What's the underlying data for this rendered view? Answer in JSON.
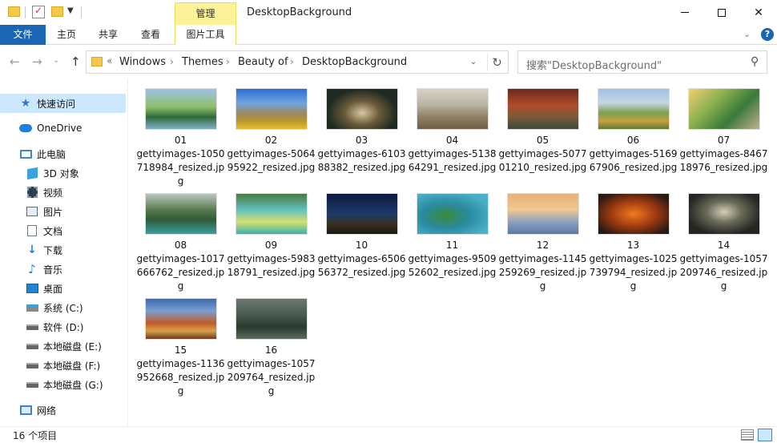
{
  "window": {
    "title": "DesktopBackground",
    "context_tab_group": "管理"
  },
  "ribbon": {
    "tabs": [
      "文件",
      "主页",
      "共享",
      "查看",
      "图片工具"
    ]
  },
  "nav": {
    "breadcrumbs": [
      "Windows",
      "Themes",
      "Beauty of",
      "DesktopBackground"
    ],
    "search_placeholder": "搜索\"DesktopBackground\""
  },
  "sidebar": {
    "items": [
      {
        "label": "快速访问",
        "icon": "star-icon"
      },
      {
        "label": "OneDrive",
        "icon": "cloud-icon"
      },
      {
        "label": "此电脑",
        "icon": "computer-icon"
      },
      {
        "label": "3D 对象",
        "icon": "cube-icon"
      },
      {
        "label": "视频",
        "icon": "video-icon"
      },
      {
        "label": "图片",
        "icon": "pictures-icon"
      },
      {
        "label": "文档",
        "icon": "document-icon"
      },
      {
        "label": "下载",
        "icon": "download-icon"
      },
      {
        "label": "音乐",
        "icon": "music-icon"
      },
      {
        "label": "桌面",
        "icon": "desktop-icon"
      },
      {
        "label": "系统 (C:)",
        "icon": "system-drive-icon"
      },
      {
        "label": "软件 (D:)",
        "icon": "drive-icon"
      },
      {
        "label": "本地磁盘 (E:)",
        "icon": "drive-icon"
      },
      {
        "label": "本地磁盘 (F:)",
        "icon": "drive-icon"
      },
      {
        "label": "本地磁盘 (G:)",
        "icon": "drive-icon"
      },
      {
        "label": "网络",
        "icon": "network-icon"
      }
    ]
  },
  "files": [
    {
      "num": "01",
      "name": "gettyimages-1050718984_resized.jpg"
    },
    {
      "num": "02",
      "name": "gettyimages-506495922_resized.jpg"
    },
    {
      "num": "03",
      "name": "gettyimages-610388382_resized.jpg"
    },
    {
      "num": "04",
      "name": "gettyimages-513864291_resized.jpg"
    },
    {
      "num": "05",
      "name": "gettyimages-507701210_resized.jpg"
    },
    {
      "num": "06",
      "name": "gettyimages-516967906_resized.jpg"
    },
    {
      "num": "07",
      "name": "gettyimages-846718976_resized.jpg"
    },
    {
      "num": "08",
      "name": "gettyimages-1017666762_resized.jpg"
    },
    {
      "num": "09",
      "name": "gettyimages-598318791_resized.jpg"
    },
    {
      "num": "10",
      "name": "gettyimages-650656372_resized.jpg"
    },
    {
      "num": "11",
      "name": "gettyimages-950952602_resized.jpg"
    },
    {
      "num": "12",
      "name": "gettyimages-1145259269_resized.jpg"
    },
    {
      "num": "13",
      "name": "gettyimages-1025739794_resized.jpg"
    },
    {
      "num": "14",
      "name": "gettyimages-1057209746_resized.jpg"
    },
    {
      "num": "15",
      "name": "gettyimages-1136952668_resized.jpg"
    },
    {
      "num": "16",
      "name": "gettyimages-1057209764_resized.jpg"
    }
  ],
  "status": {
    "item_count": "16 个项目"
  }
}
